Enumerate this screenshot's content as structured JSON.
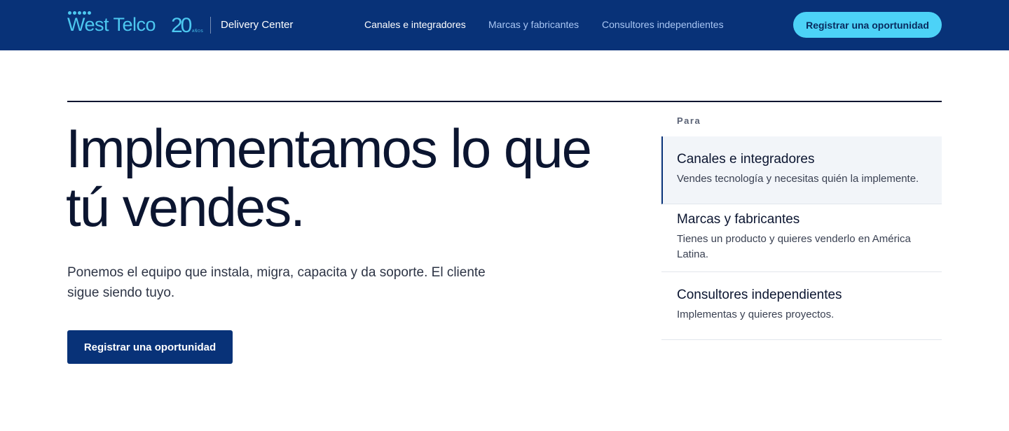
{
  "header": {
    "logo": {
      "brand": "West Telco",
      "anniversary": "20",
      "anniversary_sub": "AÑOS"
    },
    "product_name": "Delivery Center",
    "nav": [
      {
        "label": "Canales e integradores",
        "active": true
      },
      {
        "label": "Marcas y fabricantes",
        "active": false
      },
      {
        "label": "Consultores independientes",
        "active": false
      }
    ],
    "cta_label": "Registrar una oportunidad"
  },
  "hero": {
    "headline_line1": "Implementamos lo que",
    "headline_line2": "tú vendes.",
    "subtitle": "Ponemos el equipo que instala, migra, capacita y da soporte. El cliente sigue siendo tuyo.",
    "cta_label": "Registrar una oportunidad"
  },
  "audience": {
    "label": "Para",
    "items": [
      {
        "title": "Canales e integradores",
        "description": "Vendes tecnología y necesitas quién la implemente.",
        "selected": true
      },
      {
        "title": "Marcas y fabricantes",
        "description": "Tienes un producto y quieres venderlo en América Latina.",
        "selected": false
      },
      {
        "title": "Consultores independientes",
        "description": "Implementas y quieres proyectos.",
        "selected": false
      }
    ]
  },
  "colors": {
    "header_bg": "#083278",
    "accent_cyan": "#4cd2f7",
    "text_dark": "#0b1530",
    "selected_item_bg": "#f2f5f9"
  }
}
